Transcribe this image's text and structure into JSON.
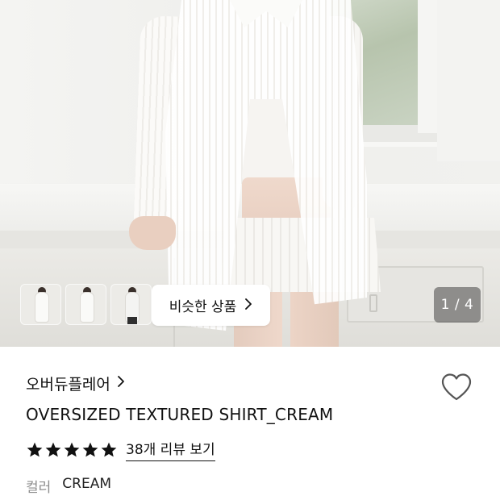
{
  "gallery": {
    "similar_button_label": "비슷한 상품",
    "counter": "1 / 4",
    "current_image": 1,
    "total_images": 4,
    "thumbnails": [
      "thumbnail-1",
      "thumbnail-2",
      "thumbnail-3"
    ]
  },
  "product": {
    "brand": "오버듀플레어",
    "title": "OVERSIZED TEXTURED SHIRT_CREAM",
    "rating": 5,
    "review_link": "38개 리뷰 보기",
    "option_label": "컬러",
    "option_value": "CREAM"
  },
  "icons": {
    "brand_chevron": "chevron-right-icon",
    "similar_chevron": "chevron-right-icon",
    "wishlist": "heart-outline-icon",
    "star": "star-filled-icon"
  },
  "colors": {
    "text": "#111111",
    "muted": "#8e8e8e",
    "heart_stroke": "#555555"
  }
}
